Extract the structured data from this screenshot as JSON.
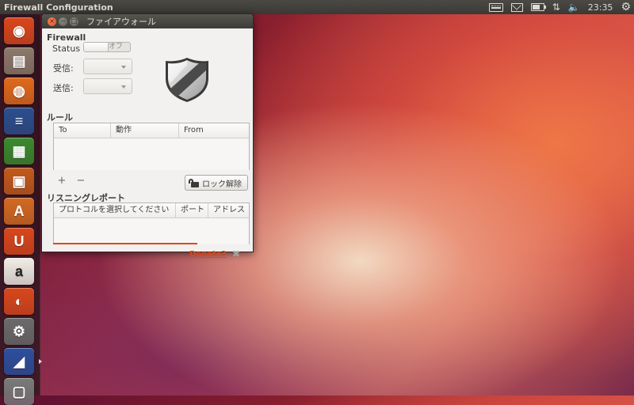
{
  "top_panel": {
    "app_title": "Firewall Configuration",
    "clock": "23:35",
    "icons": [
      "keyboard-icon",
      "mail-icon",
      "battery-icon",
      "network-icon",
      "volume-icon",
      "gear-icon"
    ]
  },
  "launcher": {
    "items": [
      {
        "name": "dash-home",
        "color": "#d9471c",
        "glyph": "◉"
      },
      {
        "name": "files",
        "color": "#8c7a6b",
        "glyph": "▤"
      },
      {
        "name": "firefox",
        "color": "#e06a1c",
        "glyph": "◍"
      },
      {
        "name": "libreoffice-writer",
        "color": "#2a4f8f",
        "glyph": "≡"
      },
      {
        "name": "libreoffice-calc",
        "color": "#3a8a2e",
        "glyph": "▦"
      },
      {
        "name": "libreoffice-impress",
        "color": "#c25a1c",
        "glyph": "▣"
      },
      {
        "name": "software-center",
        "color": "#d26a22",
        "glyph": "A"
      },
      {
        "name": "ubuntu-one",
        "color": "#d9471c",
        "glyph": "U"
      },
      {
        "name": "amazon",
        "color": "#f0ede6",
        "glyph": "a"
      },
      {
        "name": "ubuntu-one-music",
        "color": "#d9471c",
        "glyph": "◐"
      },
      {
        "name": "system-settings",
        "color": "#6b6b6b",
        "glyph": "⚙"
      },
      {
        "name": "firewall",
        "color": "#2c4f9e",
        "glyph": "◢"
      },
      {
        "name": "trash",
        "color": "#7a7a7a",
        "glyph": "▢"
      }
    ]
  },
  "window": {
    "title": "ファイアウォール",
    "firewall_heading": "Firewall",
    "status_label": "Status",
    "status_state": "オフ",
    "incoming_label": "受信:",
    "outgoing_label": "送信:",
    "rules_heading": "ルール",
    "rules_columns": [
      "To",
      "動作",
      "From"
    ],
    "add_symbol": "+",
    "remove_symbol": "−",
    "unlock_label": "ロック解除",
    "report_heading": "リスニングレポート",
    "report_columns": [
      "プロトコルを選択してください",
      "ポート",
      "アドレス"
    ],
    "donate_label": "Donate?",
    "close_symbol": "✖"
  },
  "colors": {
    "accent": "#dd4814",
    "panel": "#3c3b37",
    "window_bg": "#f2f1f0"
  }
}
